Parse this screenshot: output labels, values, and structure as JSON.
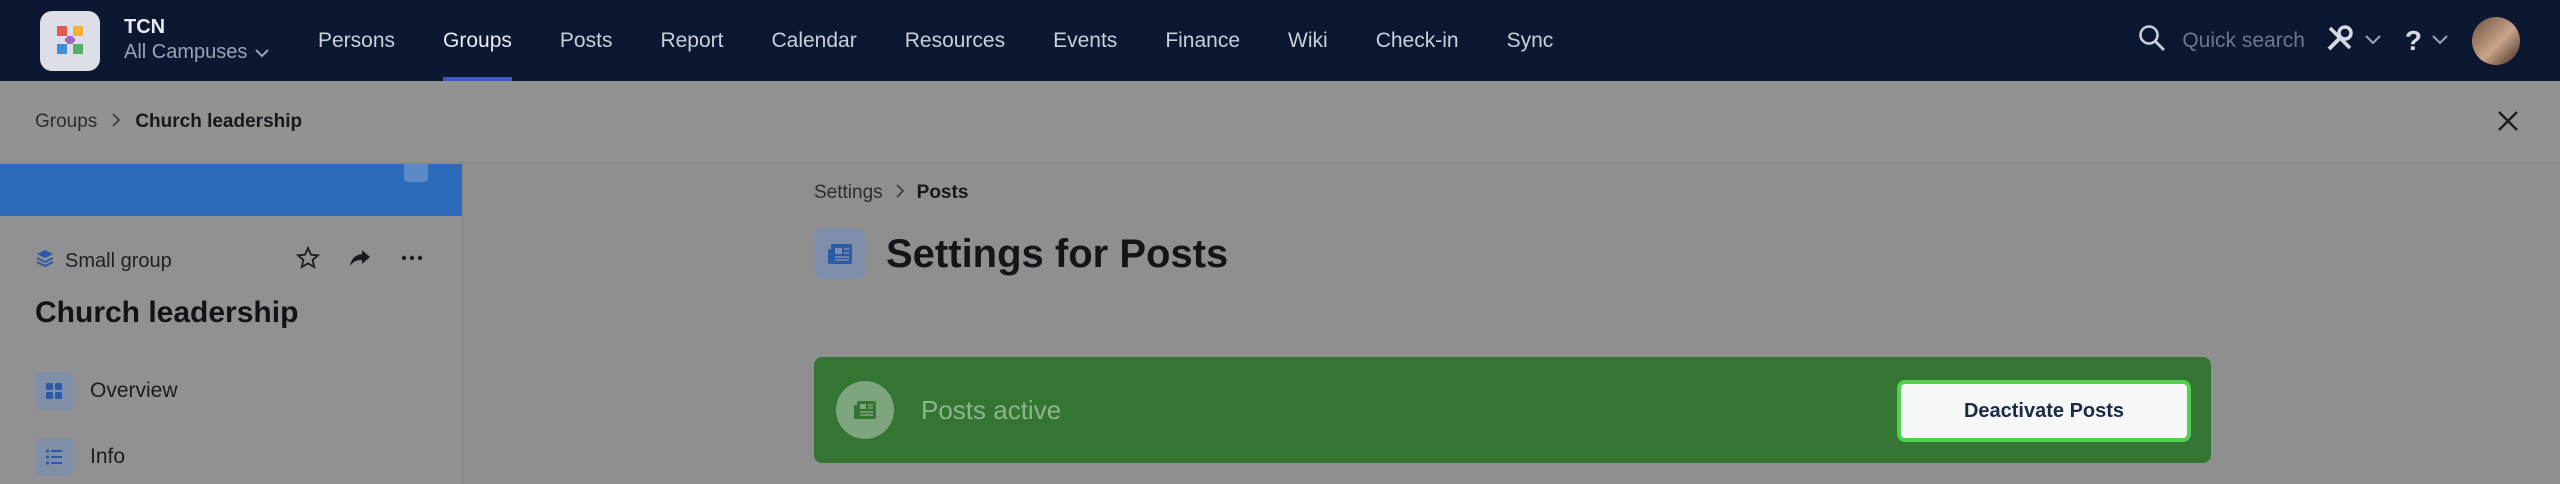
{
  "header": {
    "org_name": "TCN",
    "campus": "All Campuses",
    "nav": [
      "Persons",
      "Groups",
      "Posts",
      "Report",
      "Calendar",
      "Resources",
      "Events",
      "Finance",
      "Wiki",
      "Check-in",
      "Sync"
    ],
    "active_nav": "Groups",
    "quick_search_placeholder": "Quick search",
    "help_label": "?"
  },
  "breadcrumb": {
    "parent": "Groups",
    "current": "Church leadership"
  },
  "sidebar": {
    "group_type": "Small group",
    "group_title": "Church leadership",
    "items": [
      {
        "label": "Overview",
        "icon": "grid-icon"
      },
      {
        "label": "Info",
        "icon": "list-icon"
      }
    ]
  },
  "main": {
    "breadcrumb": {
      "parent": "Settings",
      "current": "Posts"
    },
    "title": "Settings for Posts",
    "status": {
      "text": "Posts active",
      "button_label": "Deactivate Posts"
    }
  },
  "colors": {
    "topbar": "#0c1732",
    "accent": "#3a5bbf",
    "active_card": "#347534",
    "focus_ring": "#4fd04f",
    "sidebar_banner": "#2b6bba"
  }
}
